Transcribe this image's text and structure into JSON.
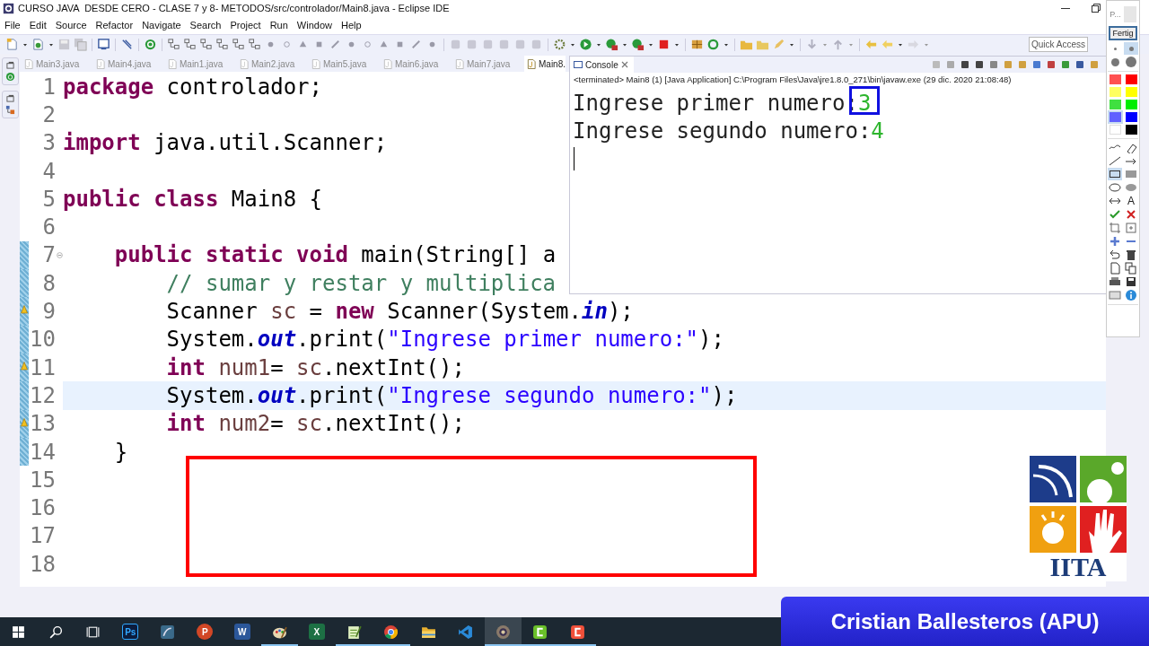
{
  "window": {
    "title": "CURSO JAVA  DESDE CERO - CLASE 7 y 8- METODOS/src/controlador/Main8.java - Eclipse IDE"
  },
  "menu": [
    "File",
    "Edit",
    "Source",
    "Refactor",
    "Navigate",
    "Search",
    "Project",
    "Run",
    "Window",
    "Help"
  ],
  "quick_access": {
    "placeholder": "Quick Access"
  },
  "editor": {
    "tabs": [
      {
        "label": "Main3.java",
        "selected": false
      },
      {
        "label": "Main4.java",
        "selected": false
      },
      {
        "label": "Main1.java",
        "selected": false
      },
      {
        "label": "Main2.java",
        "selected": false
      },
      {
        "label": "Main5.java",
        "selected": false
      },
      {
        "label": "Main6.java",
        "selected": false
      },
      {
        "label": "Main7.java",
        "selected": false
      },
      {
        "label": "Main8.",
        "selected": true
      }
    ],
    "lines": [
      {
        "number": "1",
        "current": false,
        "changed": false,
        "warning": false,
        "fold": false,
        "tokens": [
          {
            "kind": "keyword",
            "text": "package"
          },
          {
            "kind": "plain",
            "text": " controlador;"
          }
        ]
      },
      {
        "number": "2",
        "current": false,
        "changed": false,
        "warning": false,
        "fold": false
      },
      {
        "number": "3",
        "current": false,
        "changed": false,
        "warning": false,
        "fold": false,
        "tokens": [
          {
            "kind": "keyword",
            "text": "import"
          },
          {
            "kind": "plain",
            "text": " java.util.Scanner;"
          }
        ]
      },
      {
        "number": "4",
        "current": false,
        "changed": false,
        "warning": false,
        "fold": false
      },
      {
        "number": "5",
        "current": false,
        "changed": false,
        "warning": false,
        "fold": false,
        "tokens": [
          {
            "kind": "keyword",
            "text": "public"
          },
          {
            "kind": "keyword",
            "text": " class"
          },
          {
            "kind": "plain",
            "text": " Main8 {"
          }
        ]
      },
      {
        "number": "6",
        "current": false,
        "changed": false,
        "warning": false,
        "fold": false
      },
      {
        "number": "7",
        "current": false,
        "changed": true,
        "warning": false,
        "fold": true,
        "tokens": [
          {
            "kind": "keyword",
            "text": "    public"
          },
          {
            "kind": "keyword",
            "text": " static"
          },
          {
            "kind": "keyword",
            "text": " void"
          },
          {
            "kind": "plain",
            "text": " main(String[] a"
          }
        ]
      },
      {
        "number": "8",
        "current": false,
        "changed": true,
        "warning": false,
        "fold": false,
        "tokens": [
          {
            "kind": "comment",
            "text": "        // sumar y restar y multiplica"
          }
        ]
      },
      {
        "number": "9",
        "current": false,
        "changed": true,
        "warning": true,
        "fold": false,
        "tokens": [
          {
            "kind": "plain",
            "text": "        Scanner "
          },
          {
            "kind": "local",
            "text": "sc"
          },
          {
            "kind": "plain",
            "text": " = "
          },
          {
            "kind": "keyword",
            "text": "new"
          },
          {
            "kind": "plain",
            "text": " Scanner(System."
          },
          {
            "kind": "field",
            "text": "in"
          },
          {
            "kind": "plain",
            "text": ");"
          }
        ]
      },
      {
        "number": "10",
        "current": false,
        "changed": true,
        "warning": false,
        "fold": false,
        "tokens": [
          {
            "kind": "plain",
            "text": "        System."
          },
          {
            "kind": "field",
            "text": "out"
          },
          {
            "kind": "plain",
            "text": ".print("
          },
          {
            "kind": "string",
            "text": "\"Ingrese primer numero:\""
          },
          {
            "kind": "plain",
            "text": ");"
          }
        ]
      },
      {
        "number": "11",
        "current": false,
        "changed": true,
        "warning": true,
        "fold": false,
        "tokens": [
          {
            "kind": "keyword",
            "text": "        int"
          },
          {
            "kind": "local",
            "text": " num1"
          },
          {
            "kind": "plain",
            "text": "= "
          },
          {
            "kind": "local",
            "text": "sc"
          },
          {
            "kind": "plain",
            "text": ".nextInt();"
          }
        ]
      },
      {
        "number": "12",
        "current": true,
        "changed": true,
        "warning": false,
        "fold": false,
        "tokens": [
          {
            "kind": "plain",
            "text": "        System."
          },
          {
            "kind": "field",
            "text": "out"
          },
          {
            "kind": "plain",
            "text": ".print("
          },
          {
            "kind": "string",
            "text": "\"Ingrese segundo numero:\""
          },
          {
            "kind": "plain",
            "text": ");"
          }
        ]
      },
      {
        "number": "13",
        "current": false,
        "changed": true,
        "warning": true,
        "fold": false,
        "tokens": [
          {
            "kind": "keyword",
            "text": "        int"
          },
          {
            "kind": "local",
            "text": " num2"
          },
          {
            "kind": "plain",
            "text": "= "
          },
          {
            "kind": "local",
            "text": "sc"
          },
          {
            "kind": "plain",
            "text": ".nextInt();"
          }
        ]
      },
      {
        "number": "14",
        "current": false,
        "changed": true,
        "warning": false,
        "fold": false,
        "tokens": [
          {
            "kind": "plain",
            "text": "    }"
          }
        ]
      },
      {
        "number": "15",
        "current": false,
        "changed": false,
        "warning": false,
        "fold": false
      },
      {
        "number": "16",
        "current": false,
        "changed": false,
        "warning": false,
        "fold": false
      },
      {
        "number": "17",
        "current": false,
        "changed": false,
        "warning": false,
        "fold": false
      },
      {
        "number": "18",
        "current": false,
        "changed": false,
        "warning": false,
        "fold": false
      }
    ]
  },
  "console": {
    "tab": "Console",
    "status": "<terminated> Main8 (1) [Java Application] C:\\Program Files\\Java\\jre1.8.0_271\\bin\\javaw.exe (29 dic. 2020 21:08:48)",
    "output": [
      {
        "segments": [
          {
            "kind": "output",
            "text": "Ingrese primer numero:"
          },
          {
            "kind": "input",
            "text": "3"
          }
        ]
      },
      {
        "segments": [
          {
            "kind": "output",
            "text": "Ingrese segundo numero:"
          },
          {
            "kind": "input",
            "text": "4"
          }
        ]
      }
    ]
  },
  "pen_toolbar": {
    "title": "P...",
    "done_button": "Fertig",
    "pen_sizes": [
      {
        "selected": false
      },
      {
        "selected": true
      },
      {
        "selected": false
      },
      {
        "selected": false
      }
    ],
    "colors": [
      {
        "color": "#ff5050",
        "selected": false
      },
      {
        "color": "#ff0000",
        "selected": false
      },
      {
        "color": "#ffff60",
        "selected": false
      },
      {
        "color": "#ffff00",
        "selected": false
      },
      {
        "color": "#40e040",
        "selected": false
      },
      {
        "color": "#00ee00",
        "selected": false
      },
      {
        "color": "#6060ff",
        "selected": true
      },
      {
        "color": "#0000ff",
        "selected": false
      },
      {
        "color": "#ffffff",
        "selected": false
      },
      {
        "color": "#000000",
        "selected": false
      }
    ],
    "tools": [
      {
        "kind": "freehand",
        "selected": false
      },
      {
        "kind": "eraser",
        "selected": false
      },
      {
        "kind": "line",
        "selected": false
      },
      {
        "kind": "arrow",
        "selected": false
      },
      {
        "kind": "rectangle",
        "selected": true
      },
      {
        "kind": "filled-rectangle",
        "selected": false
      },
      {
        "kind": "ellipse",
        "selected": false
      },
      {
        "kind": "filled-ellipse",
        "selected": false
      },
      {
        "kind": "double-arrow",
        "selected": false
      },
      {
        "kind": "text",
        "label": "A",
        "selected": false
      },
      {
        "kind": "check",
        "selected": false
      },
      {
        "kind": "cross",
        "selected": false
      },
      {
        "kind": "crop",
        "selected": false
      },
      {
        "kind": "zoom",
        "selected": false
      },
      {
        "kind": "plus",
        "selected": false
      },
      {
        "kind": "minus",
        "selected": false
      },
      {
        "kind": "undo",
        "selected": false
      },
      {
        "kind": "trash",
        "selected": false
      },
      {
        "kind": "new-page",
        "selected": false
      },
      {
        "kind": "copy",
        "selected": false
      },
      {
        "kind": "print",
        "selected": false
      },
      {
        "kind": "save",
        "selected": false
      },
      {
        "kind": "screen",
        "selected": false
      },
      {
        "kind": "info",
        "selected": false
      }
    ]
  },
  "taskbar": [
    {
      "kind": "start",
      "running": false,
      "active": false
    },
    {
      "kind": "search",
      "running": false,
      "active": false
    },
    {
      "kind": "task-view",
      "running": false,
      "active": false
    },
    {
      "kind": "photoshop",
      "label": "Ps",
      "running": false,
      "active": false
    },
    {
      "kind": "dolphin",
      "running": false,
      "active": false
    },
    {
      "kind": "powerpoint",
      "label": "P",
      "running": false,
      "active": false
    },
    {
      "kind": "word",
      "label": "W",
      "running": false,
      "active": false
    },
    {
      "kind": "paint",
      "running": true,
      "active": false
    },
    {
      "kind": "excel",
      "label": "X",
      "running": false,
      "active": false
    },
    {
      "kind": "notepad",
      "running": true,
      "active": false
    },
    {
      "kind": "chrome",
      "running": true,
      "active": false
    },
    {
      "kind": "folder",
      "running": false,
      "active": false
    },
    {
      "kind": "vscode",
      "running": false,
      "active": false
    },
    {
      "kind": "eclipse",
      "running": true,
      "active": true
    },
    {
      "kind": "recorder-green",
      "running": true,
      "active": false
    },
    {
      "kind": "recorder-red",
      "running": true,
      "active": false
    }
  ],
  "logo": {
    "text": "IITA"
  },
  "banner": {
    "presenter": "Cristian Ballesteros (APU)"
  }
}
